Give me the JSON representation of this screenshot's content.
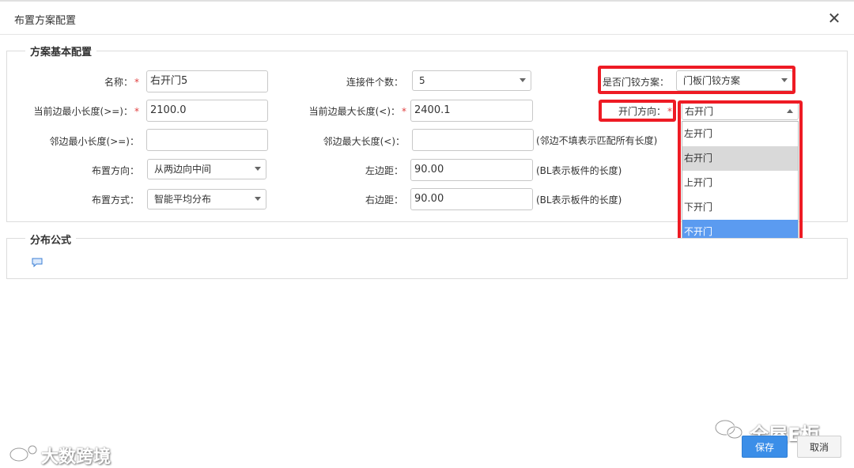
{
  "dialog": {
    "title": "布置方案配置",
    "close_glyph": "✕"
  },
  "basic_section": {
    "legend": "方案基本配置",
    "name": {
      "label": "名称：",
      "value": "右开门5"
    },
    "connector_count": {
      "label": "连接件个数：",
      "value": "5"
    },
    "hinge_scheme": {
      "label": "是否门铰方案：",
      "value": "门板门铰方案"
    },
    "cur_edge_min": {
      "label": "当前边最小长度(>=)：",
      "value": "2100.0"
    },
    "cur_edge_max": {
      "label": "当前边最大长度(<)：",
      "value": "2400.1"
    },
    "door_direction": {
      "label": "开门方向：",
      "value": "右开门"
    },
    "adj_edge_min": {
      "label": "邻边最小长度(>=)：",
      "value": ""
    },
    "adj_edge_max": {
      "label": "邻边最大长度(<)：",
      "value": "",
      "hint": "(邻边不填表示匹配所有长度)"
    },
    "layout_direction": {
      "label": "布置方向：",
      "value": "从两边向中间"
    },
    "left_margin": {
      "label": "左边距：",
      "value": "90.00",
      "hint": "(BL表示板件的长度)"
    },
    "layout_mode": {
      "label": "布置方式：",
      "value": "智能平均分布"
    },
    "right_margin": {
      "label": "右边距：",
      "value": "90.00",
      "hint": "(BL表示板件的长度)"
    },
    "required_mark": "*"
  },
  "door_direction_options": [
    "左开门",
    "右开门",
    "上开门",
    "下开门",
    "不开门"
  ],
  "formula_section": {
    "legend": "分布公式"
  },
  "footer": {
    "save_label": "保存",
    "cancel_label": "取消"
  },
  "watermarks": {
    "left": "大数跨境",
    "right": "全屋E柜"
  },
  "colors": {
    "highlight_red": "#ee1b24",
    "primary_blue": "#3b8ee8",
    "selected_option": "#5b9bf0"
  }
}
